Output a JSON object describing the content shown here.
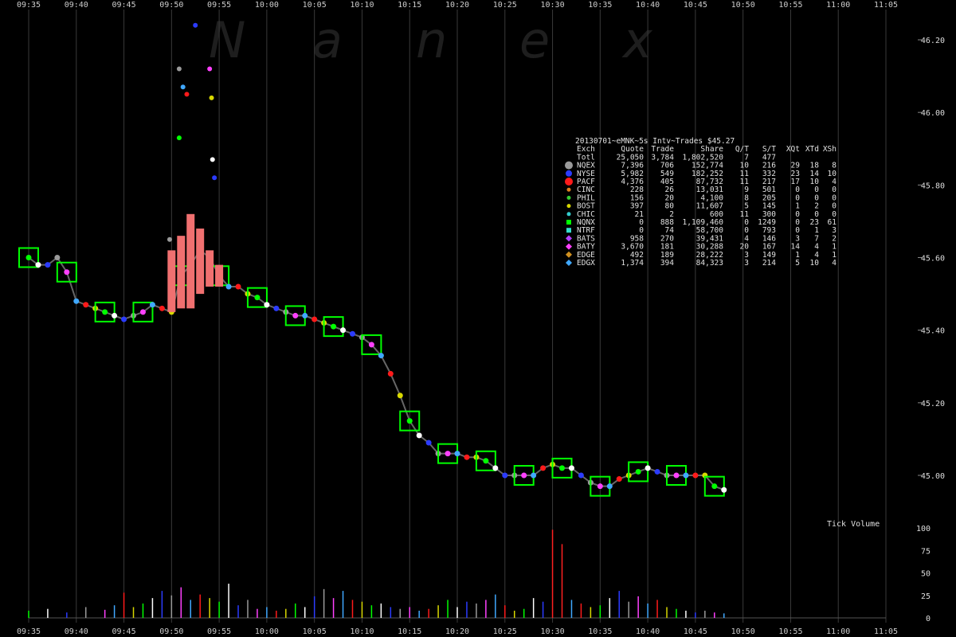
{
  "chart_data": {
    "type": "scatter",
    "watermark": [
      "N",
      "a",
      "n",
      "e",
      "x"
    ],
    "x_ticks": [
      "09:35",
      "09:40",
      "09:45",
      "09:50",
      "09:55",
      "10:00",
      "10:05",
      "10:10",
      "10:15",
      "10:20",
      "10:25",
      "10:30",
      "10:35",
      "10:40",
      "10:45",
      "10:50",
      "10:55",
      "11:00",
      "11:05"
    ],
    "price_ticks": [
      "45.00",
      "45.20",
      "45.40",
      "45.60",
      "45.80",
      "46.00",
      "46.20"
    ],
    "volume_ticks": [
      "0",
      "25",
      "50",
      "75",
      "100"
    ],
    "volume_label": "Tick Volume",
    "ylim_price": [
      44.88,
      46.25
    ],
    "ylim_volume": [
      0,
      100
    ],
    "xlim_minutes": [
      0,
      90
    ],
    "table": {
      "title": "20130701~eMNK~5s Intv~Trades $45.27",
      "columns": [
        "Exch",
        "Quote",
        "Trade",
        "Share",
        "Q/T",
        "S/T",
        "XQt",
        "XTd",
        "XSh"
      ],
      "rows": [
        {
          "exch": "Totl",
          "quote": "25,050",
          "trade": "3,784",
          "share": "1,802,520",
          "qt": "7",
          "st": "477",
          "xqt": "",
          "xtd": "",
          "xsh": "",
          "color": "",
          "marker": "none"
        },
        {
          "exch": "NQEX",
          "quote": "7,396",
          "trade": "706",
          "share": "152,774",
          "qt": "10",
          "st": "216",
          "xqt": "29",
          "xtd": "18",
          "xsh": "8",
          "color": "#9a9a9a",
          "marker": "big-circle"
        },
        {
          "exch": "NYSE",
          "quote": "5,982",
          "trade": "549",
          "share": "182,252",
          "qt": "11",
          "st": "332",
          "xqt": "23",
          "xtd": "14",
          "xsh": "10",
          "color": "#2b3bff",
          "marker": "circle"
        },
        {
          "exch": "PACF",
          "quote": "4,376",
          "trade": "405",
          "share": "87,732",
          "qt": "11",
          "st": "217",
          "xqt": "17",
          "xtd": "10",
          "xsh": "4",
          "color": "#ff1a1a",
          "marker": "big-circle"
        },
        {
          "exch": "CINC",
          "quote": "228",
          "trade": "26",
          "share": "13,031",
          "qt": "9",
          "st": "501",
          "xqt": "0",
          "xtd": "0",
          "xsh": "0",
          "color": "#e08020",
          "marker": "small-circle"
        },
        {
          "exch": "PHIL",
          "quote": "156",
          "trade": "20",
          "share": "4,100",
          "qt": "8",
          "st": "205",
          "xqt": "0",
          "xtd": "0",
          "xsh": "0",
          "color": "#33cc33",
          "marker": "small-circle"
        },
        {
          "exch": "BOST",
          "quote": "397",
          "trade": "80",
          "share": "11,607",
          "qt": "5",
          "st": "145",
          "xqt": "1",
          "xtd": "2",
          "xsh": "0",
          "color": "#d8d800",
          "marker": "small-circle"
        },
        {
          "exch": "CHIC",
          "quote": "21",
          "trade": "2",
          "share": "600",
          "qt": "11",
          "st": "300",
          "xqt": "0",
          "xtd": "0",
          "xsh": "0",
          "color": "#33cccc",
          "marker": "small-circle"
        },
        {
          "exch": "NQNX",
          "quote": "0",
          "trade": "888",
          "share": "1,109,460",
          "qt": "0",
          "st": "1249",
          "xqt": "0",
          "xtd": "23",
          "xsh": "61",
          "color": "#00ff00",
          "marker": "square"
        },
        {
          "exch": "NTRF",
          "quote": "0",
          "trade": "74",
          "share": "58,700",
          "qt": "0",
          "st": "793",
          "xqt": "0",
          "xtd": "1",
          "xsh": "3",
          "color": "#33ddcc",
          "marker": "square"
        },
        {
          "exch": "BATS",
          "quote": "958",
          "trade": "270",
          "share": "39,431",
          "qt": "4",
          "st": "146",
          "xqt": "3",
          "xtd": "7",
          "xsh": "2",
          "color": "#b040ff",
          "marker": "diamond"
        },
        {
          "exch": "BATY",
          "quote": "3,670",
          "trade": "181",
          "share": "30,288",
          "qt": "20",
          "st": "167",
          "xqt": "14",
          "xtd": "4",
          "xsh": "1",
          "color": "#ff40ff",
          "marker": "diamond"
        },
        {
          "exch": "EDGE",
          "quote": "492",
          "trade": "189",
          "share": "28,222",
          "qt": "3",
          "st": "149",
          "xqt": "1",
          "xtd": "4",
          "xsh": "1",
          "color": "#d09020",
          "marker": "diamond"
        },
        {
          "exch": "EDGX",
          "quote": "1,374",
          "trade": "394",
          "share": "84,323",
          "qt": "3",
          "st": "214",
          "xqt": "5",
          "xtd": "10",
          "xsh": "4",
          "color": "#40a8ff",
          "marker": "diamond"
        }
      ]
    },
    "price_trace": [
      [
        0,
        45.6
      ],
      [
        1,
        45.58
      ],
      [
        2,
        45.58
      ],
      [
        3,
        45.6
      ],
      [
        4,
        45.56
      ],
      [
        5,
        45.48
      ],
      [
        6,
        45.47
      ],
      [
        7,
        45.46
      ],
      [
        8,
        45.45
      ],
      [
        9,
        45.44
      ],
      [
        10,
        45.43
      ],
      [
        11,
        45.44
      ],
      [
        12,
        45.45
      ],
      [
        13,
        45.47
      ],
      [
        14,
        45.46
      ],
      [
        15,
        45.45
      ],
      [
        16,
        45.55
      ],
      [
        17,
        45.58
      ],
      [
        18,
        45.62
      ],
      [
        19,
        45.6
      ],
      [
        20,
        45.55
      ],
      [
        21,
        45.52
      ],
      [
        22,
        45.52
      ],
      [
        23,
        45.5
      ],
      [
        24,
        45.49
      ],
      [
        25,
        45.47
      ],
      [
        26,
        45.46
      ],
      [
        27,
        45.45
      ],
      [
        28,
        45.44
      ],
      [
        29,
        45.44
      ],
      [
        30,
        45.43
      ],
      [
        31,
        45.42
      ],
      [
        32,
        45.41
      ],
      [
        33,
        45.4
      ],
      [
        34,
        45.39
      ],
      [
        35,
        45.38
      ],
      [
        36,
        45.36
      ],
      [
        37,
        45.33
      ],
      [
        38,
        45.28
      ],
      [
        39,
        45.22
      ],
      [
        40,
        45.15
      ],
      [
        41,
        45.11
      ],
      [
        42,
        45.09
      ],
      [
        43,
        45.06
      ],
      [
        44,
        45.06
      ],
      [
        45,
        45.06
      ],
      [
        46,
        45.05
      ],
      [
        47,
        45.05
      ],
      [
        48,
        45.04
      ],
      [
        49,
        45.02
      ],
      [
        50,
        45.0
      ],
      [
        51,
        45.0
      ],
      [
        52,
        45.0
      ],
      [
        53,
        45.0
      ],
      [
        54,
        45.02
      ],
      [
        55,
        45.03
      ],
      [
        56,
        45.02
      ],
      [
        57,
        45.02
      ],
      [
        58,
        45.0
      ],
      [
        59,
        44.98
      ],
      [
        60,
        44.97
      ],
      [
        61,
        44.97
      ],
      [
        62,
        44.99
      ],
      [
        63,
        45.0
      ],
      [
        64,
        45.01
      ],
      [
        65,
        45.02
      ],
      [
        66,
        45.01
      ],
      [
        67,
        45.0
      ],
      [
        68,
        45.0
      ],
      [
        69,
        45.0
      ],
      [
        70,
        45.0
      ],
      [
        71,
        45.0
      ],
      [
        72,
        44.97
      ],
      [
        73,
        44.96
      ]
    ],
    "price_spikes": [
      [
        17.5,
        46.24
      ],
      [
        15.8,
        46.12
      ],
      [
        19.0,
        46.12
      ],
      [
        16.2,
        46.07
      ],
      [
        16.6,
        46.05
      ],
      [
        19.2,
        46.04
      ],
      [
        15.8,
        45.93
      ],
      [
        19.3,
        45.87
      ],
      [
        19.5,
        45.82
      ],
      [
        14.8,
        45.65
      ]
    ],
    "volume": [
      [
        0,
        8
      ],
      [
        2,
        10
      ],
      [
        4,
        6
      ],
      [
        6,
        12
      ],
      [
        8,
        9
      ],
      [
        9,
        14
      ],
      [
        10,
        28
      ],
      [
        11,
        12
      ],
      [
        12,
        16
      ],
      [
        13,
        22
      ],
      [
        14,
        30
      ],
      [
        15,
        25
      ],
      [
        16,
        34
      ],
      [
        17,
        20
      ],
      [
        18,
        26
      ],
      [
        19,
        22
      ],
      [
        20,
        18
      ],
      [
        21,
        38
      ],
      [
        22,
        14
      ],
      [
        23,
        20
      ],
      [
        24,
        10
      ],
      [
        25,
        12
      ],
      [
        26,
        8
      ],
      [
        27,
        10
      ],
      [
        28,
        16
      ],
      [
        29,
        12
      ],
      [
        30,
        24
      ],
      [
        31,
        32
      ],
      [
        32,
        22
      ],
      [
        33,
        30
      ],
      [
        34,
        20
      ],
      [
        35,
        18
      ],
      [
        36,
        14
      ],
      [
        37,
        16
      ],
      [
        38,
        12
      ],
      [
        39,
        10
      ],
      [
        40,
        12
      ],
      [
        41,
        8
      ],
      [
        42,
        10
      ],
      [
        43,
        14
      ],
      [
        44,
        20
      ],
      [
        45,
        12
      ],
      [
        46,
        18
      ],
      [
        47,
        16
      ],
      [
        48,
        20
      ],
      [
        49,
        26
      ],
      [
        50,
        14
      ],
      [
        51,
        8
      ],
      [
        52,
        10
      ],
      [
        53,
        22
      ],
      [
        54,
        18
      ],
      [
        55,
        98
      ],
      [
        56,
        82
      ],
      [
        57,
        20
      ],
      [
        58,
        16
      ],
      [
        59,
        12
      ],
      [
        60,
        14
      ],
      [
        61,
        22
      ],
      [
        62,
        30
      ],
      [
        63,
        18
      ],
      [
        64,
        24
      ],
      [
        65,
        16
      ],
      [
        66,
        20
      ],
      [
        67,
        12
      ],
      [
        68,
        10
      ],
      [
        69,
        8
      ],
      [
        70,
        6
      ],
      [
        71,
        8
      ],
      [
        72,
        6
      ],
      [
        73,
        5
      ]
    ]
  }
}
